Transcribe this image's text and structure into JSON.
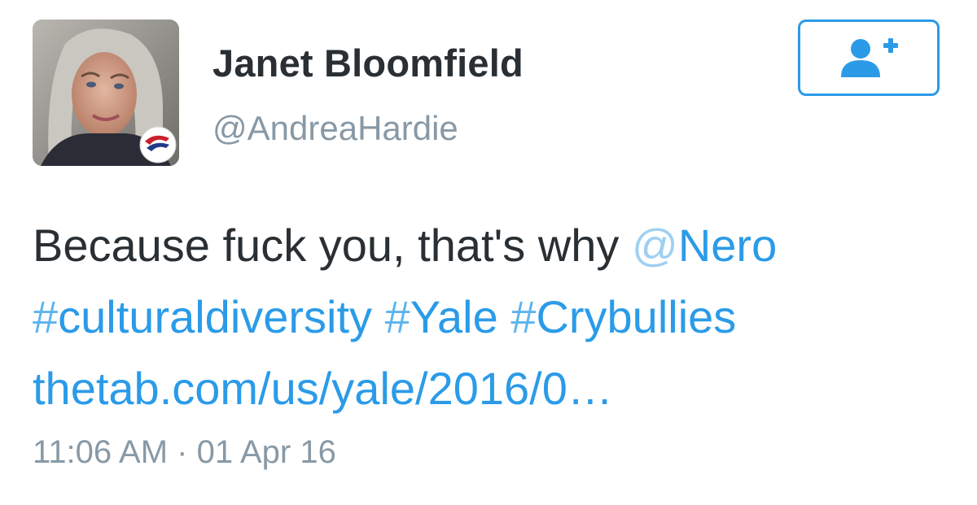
{
  "tweet": {
    "display_name": "Janet Bloomfield",
    "handle": "@AndreaHardie",
    "follow_button": {
      "icon": "follow-user-plus-icon"
    },
    "text": {
      "line1_prefix": "Because fuck you, that's why ",
      "mention_at": "@",
      "mention_name": "Nero",
      "hashtags": [
        {
          "symbol": "#",
          "tag": "culturaldiversity"
        },
        {
          "symbol": "#",
          "tag": "Yale"
        },
        {
          "symbol": "#",
          "tag": "Crybullies"
        }
      ],
      "link": "thetab.com/us/yale/2016/0…"
    },
    "timestamp": "11:06 AM · 01 Apr 16"
  },
  "colors": {
    "link_blue": "#2b9be8",
    "text_dark": "#292f33",
    "text_gray": "#8899a6"
  }
}
